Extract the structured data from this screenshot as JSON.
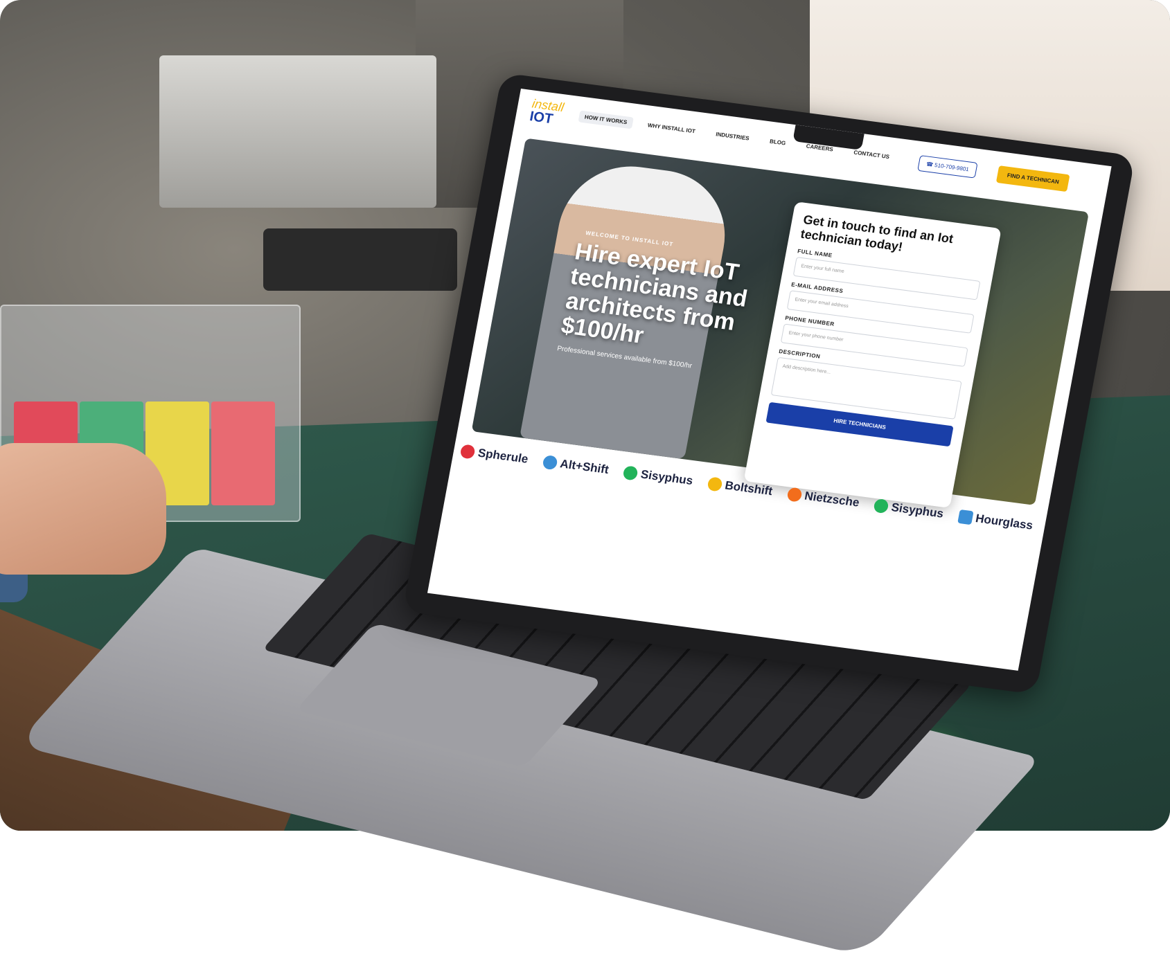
{
  "site": {
    "logo_line1": "install",
    "logo_line2": "IOT",
    "nav": [
      "HOW IT WORKS",
      "WHY INSTALL IOT",
      "INDUSTRIES",
      "BLOG",
      "CAREERS",
      "CONTACT US"
    ],
    "phone": "510-709-9801",
    "cta": "FIND A TECHNICAN"
  },
  "hero": {
    "welcome": "WELCOME TO INSTALL IOT",
    "title": "Hire expert IoT technicians and architects from $100/hr",
    "subtitle": "Professional services available from $100/hr"
  },
  "form": {
    "title": "Get in touch to find an Iot technician today!",
    "full_name_label": "FULL NAME",
    "full_name_placeholder": "Enter your full name",
    "email_label": "E-MAIL ADDRESS",
    "email_placeholder": "Enter your email address",
    "phone_label": "PHONE NUMBER",
    "phone_placeholder": "Enter your phone number",
    "description_label": "DESCRIPTION",
    "description_placeholder": "Add description here...",
    "submit": "HIRE TECHNICIANS"
  },
  "partners": [
    {
      "name": "Spherule",
      "color": "#e0313b"
    },
    {
      "name": "Alt+Shift",
      "color": "#3b8fd6"
    },
    {
      "name": "Sisyphus",
      "color": "#22b35a"
    },
    {
      "name": "Boltshift",
      "color": "#f3b70f"
    },
    {
      "name": "Nietzsche",
      "color": "#f26d1c"
    },
    {
      "name": "Sisyphus",
      "color": "#22b35a"
    },
    {
      "name": "Hourglass",
      "color": "#3b8fd6"
    }
  ]
}
